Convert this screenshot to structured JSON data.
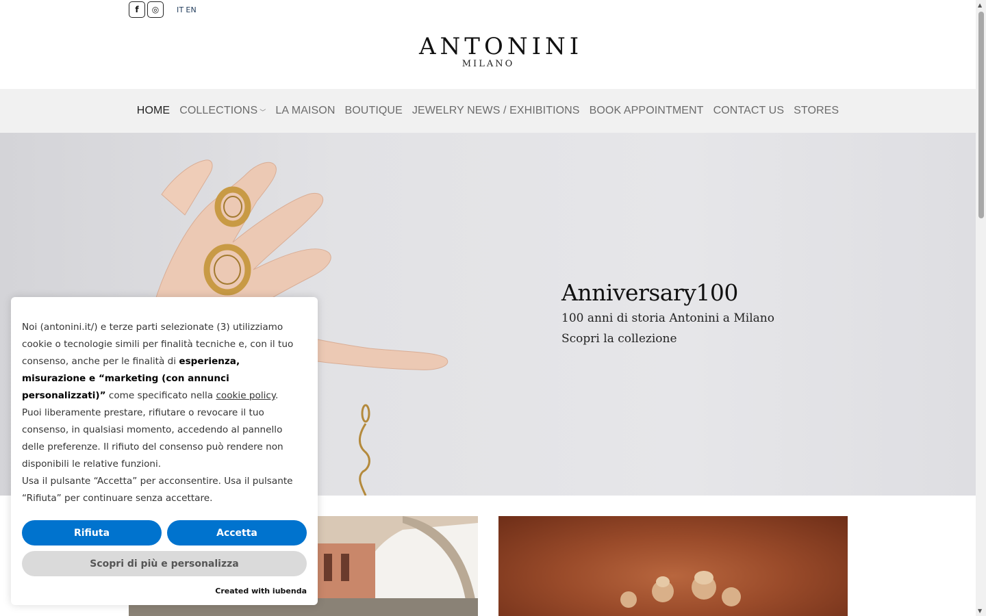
{
  "topbar": {
    "social": [
      {
        "name": "facebook-icon",
        "glyph": "f"
      },
      {
        "name": "instagram-icon",
        "glyph": "◎"
      }
    ],
    "lang": {
      "it": "IT",
      "en": "EN"
    }
  },
  "logo": {
    "brand": "ANTONINI",
    "city": "MILANO"
  },
  "nav": {
    "items": [
      {
        "label": "HOME",
        "active": true
      },
      {
        "label": "COLLECTIONS",
        "has_dropdown": true
      },
      {
        "label": "LA MAISON"
      },
      {
        "label": "BOUTIQUE"
      },
      {
        "label": "JEWELRY NEWS / EXHIBITIONS"
      },
      {
        "label": "BOOK APPOINTMENT"
      },
      {
        "label": "CONTACT US"
      },
      {
        "label": "STORES"
      }
    ]
  },
  "hero": {
    "title": "Anniversary100",
    "subtitle": "100 anni di storia Antonini a Milano",
    "link": "Scopri la collezione"
  },
  "cookie": {
    "p1_a": "Noi (antonini.it/) e terze parti selezionate (3) utilizziamo cookie o tecnologie simili per finalità tecniche e, con il tuo consenso, anche per le finalità di ",
    "p1_bold": "esperienza, misurazione e “marketing (con annunci personalizzati)”",
    "p1_b": " come specificato nella ",
    "p1_link": "cookie policy",
    "p1_c": ".",
    "p2": "Puoi liberamente prestare, rifiutare o revocare il tuo consenso, in qualsiasi momento, accedendo al pannello delle preferenze. Il rifiuto del consenso può rendere non disponibili le relative funzioni.",
    "p3": "Usa il pulsante “Accetta” per acconsentire. Usa il pulsante “Rifiuta” per continuare senza accettare.",
    "reject": "Rifiuta",
    "accept": "Accetta",
    "more": "Scopri di più e personalizza",
    "created": "Created with iubenda"
  },
  "colors": {
    "accent_button": "#0073ce",
    "nav_bg": "#f1f1f1"
  }
}
